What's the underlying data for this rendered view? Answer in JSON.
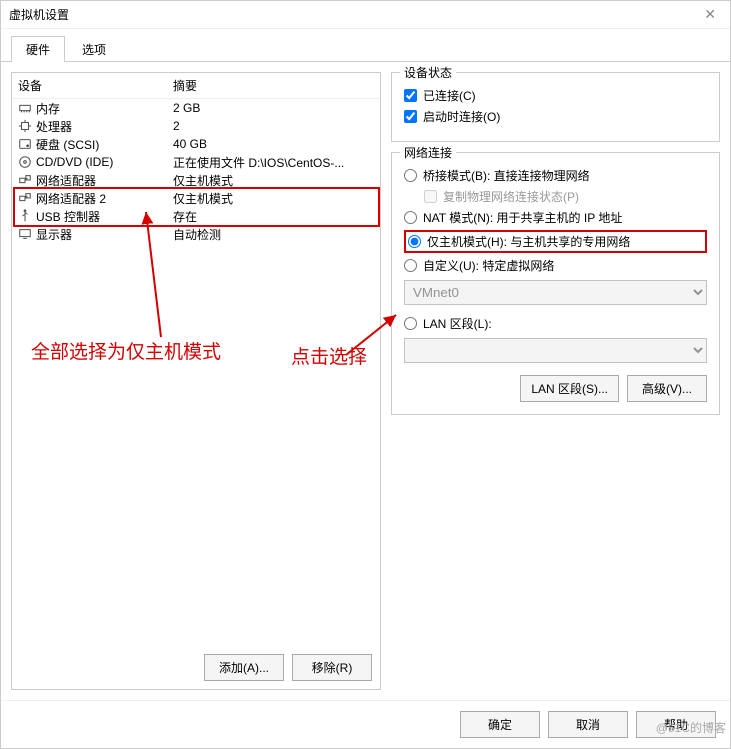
{
  "window": {
    "title": "虚拟机设置"
  },
  "tabs": {
    "hardware": "硬件",
    "options": "选项"
  },
  "list": {
    "header_device": "设备",
    "header_summary": "摘要",
    "rows": [
      {
        "icon": "memory-icon",
        "name": "内存",
        "summary": "2 GB"
      },
      {
        "icon": "cpu-icon",
        "name": "处理器",
        "summary": "2"
      },
      {
        "icon": "disk-icon",
        "name": "硬盘 (SCSI)",
        "summary": "40 GB"
      },
      {
        "icon": "cd-icon",
        "name": "CD/DVD (IDE)",
        "summary": "正在使用文件 D:\\IOS\\CentOS-..."
      },
      {
        "icon": "net-icon",
        "name": "网络适配器",
        "summary": "仅主机模式"
      },
      {
        "icon": "net-icon",
        "name": "网络适配器 2",
        "summary": "仅主机模式"
      },
      {
        "icon": "usb-icon",
        "name": "USB 控制器",
        "summary": "存在"
      },
      {
        "icon": "display-icon",
        "name": "显示器",
        "summary": "自动检测"
      }
    ]
  },
  "left_buttons": {
    "add": "添加(A)...",
    "remove": "移除(R)"
  },
  "status": {
    "title": "设备状态",
    "connected": "已连接(C)",
    "connect_on": "启动时连接(O)"
  },
  "net": {
    "title": "网络连接",
    "bridged": "桥接模式(B): 直接连接物理网络",
    "replicate": "复制物理网络连接状态(P)",
    "nat": "NAT 模式(N): 用于共享主机的 IP 地址",
    "hostonly": "仅主机模式(H): 与主机共享的专用网络",
    "custom": "自定义(U): 特定虚拟网络",
    "vmnet": "VMnet0",
    "lan": "LAN 区段(L):",
    "lan_btn": "LAN 区段(S)...",
    "adv_btn": "高级(V)..."
  },
  "footer": {
    "ok": "确定",
    "cancel": "取消",
    "help": "帮助"
  },
  "annot": {
    "left": "全部选择为仅主机模式",
    "right": "点击选择"
  },
  "watermark": "@51C的博客"
}
